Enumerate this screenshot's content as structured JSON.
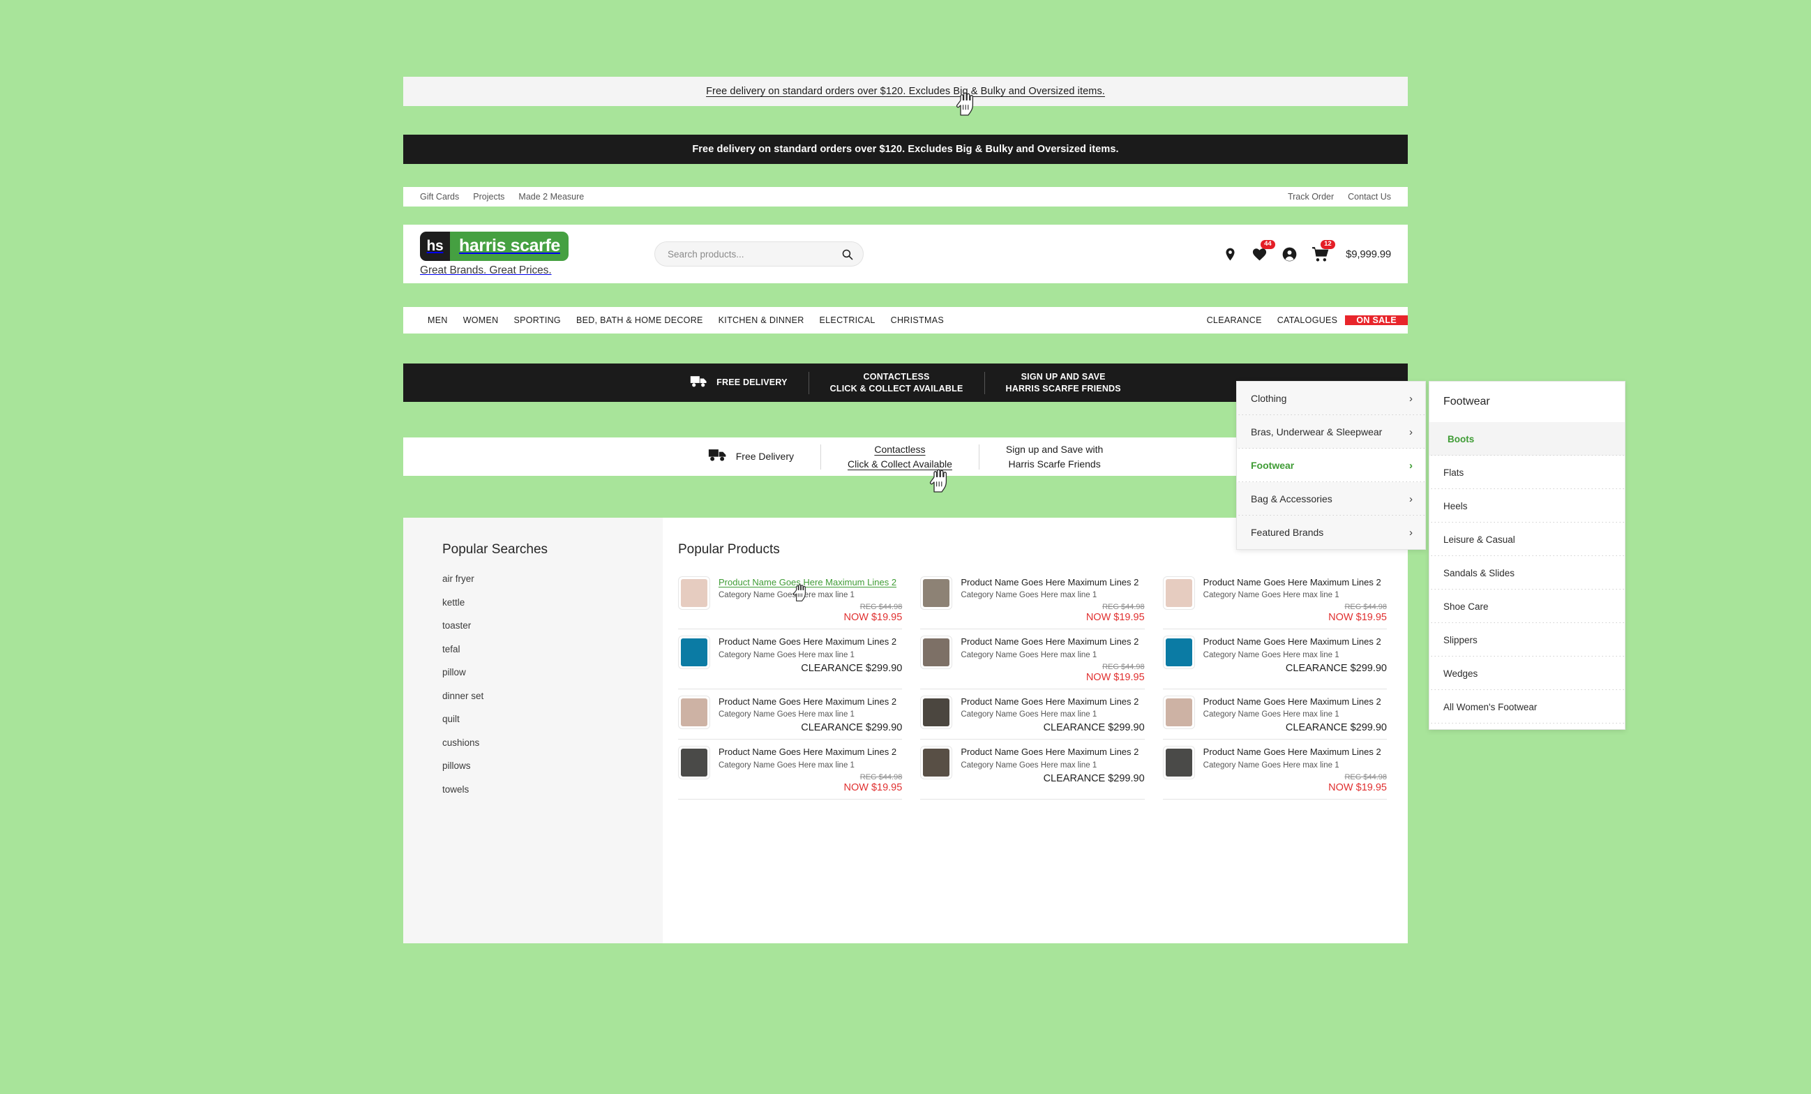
{
  "promo_light": {
    "text": "Free delivery on standard orders over $120. Excludes Big & Bulky and Oversized items."
  },
  "promo_dark": {
    "text": "Free delivery on standard orders over $120. Excludes Big & Bulky and Oversized items."
  },
  "utility": {
    "left": [
      {
        "label": "Gift Cards"
      },
      {
        "label": "Projects"
      },
      {
        "label": "Made 2 Measure"
      }
    ],
    "right": [
      {
        "label": "Track Order"
      },
      {
        "label": "Contact Us"
      }
    ]
  },
  "brand": {
    "mark": "hs",
    "name": "harris scarfe",
    "tagline": "Great Brands. Great Prices.",
    "mark_color": "#1d1d1d",
    "name_color": "#45a041"
  },
  "search": {
    "placeholder": "Search products...",
    "value": ""
  },
  "header_icons": {
    "store_locator": "location-pin-icon",
    "wishlist": {
      "icon": "heart-icon",
      "badge": "44"
    },
    "account": "account-icon",
    "cart": {
      "icon": "cart-icon",
      "badge": "12",
      "total": "$9,999.99"
    },
    "badge_color": "#e41e26"
  },
  "mainnav": {
    "left": [
      {
        "label": "MEN"
      },
      {
        "label": "WOMEN"
      },
      {
        "label": "SPORTING"
      },
      {
        "label": "BED, BATH & HOME DECORE"
      },
      {
        "label": "KITCHEN & DINNER"
      },
      {
        "label": "ELECTRICAL"
      },
      {
        "label": "CHRISTMAS"
      }
    ],
    "right": [
      {
        "label": "CLEARANCE"
      },
      {
        "label": "CATALOGUES"
      }
    ],
    "onsale": {
      "label": "ON SALE",
      "color": "#e8252b"
    }
  },
  "featurebar_dark": {
    "delivery": "FREE DELIVERY",
    "contactless_l1": "CONTACTLESS",
    "contactless_l2": "CLICK & COLLECT AVAILABLE",
    "signup_l1": "SIGN UP AND SAVE",
    "signup_l2": "HARRIS SCARFE FRIENDS"
  },
  "featurebar_light": {
    "delivery": "Free Delivery",
    "contactless_l1": "Contactless",
    "contactless_l2": "Click & Collect Available",
    "signup_l1": "Sign up and Save with",
    "signup_l2": "Harris Scarfe Friends"
  },
  "sidebar": {
    "title": "Popular Searches",
    "items": [
      {
        "label": "air fryer"
      },
      {
        "label": "kettle"
      },
      {
        "label": "toaster"
      },
      {
        "label": "tefal"
      },
      {
        "label": "pillow"
      },
      {
        "label": "dinner set"
      },
      {
        "label": "quilt"
      },
      {
        "label": "cushions"
      },
      {
        "label": "pillows"
      },
      {
        "label": "towels"
      }
    ]
  },
  "products": {
    "title": "Popular Products",
    "items": [
      {
        "name": "Product Name Goes Here Maximum Lines 2",
        "category": "Category Name Goes Here max line 1",
        "reg": "REG $44.98",
        "now": "NOW $19.95",
        "clearance": "",
        "active": true,
        "thumb": "#e6ccc0"
      },
      {
        "name": "Product Name Goes Here Maximum Lines 2",
        "category": "Category Name Goes Here max line 1",
        "reg": "REG $44.98",
        "now": "NOW $19.95",
        "clearance": "",
        "active": false,
        "thumb": "#8d8275"
      },
      {
        "name": "Product Name Goes Here Maximum Lines 2",
        "category": "Category Name Goes Here max line 1",
        "reg": "REG $44.98",
        "now": "NOW $19.95",
        "clearance": "",
        "active": false,
        "thumb": "#e6ccc0"
      },
      {
        "name": "Product Name Goes Here Maximum Lines 2",
        "category": "Category Name Goes Here max line 1",
        "reg": "",
        "now": "",
        "clearance": "CLEARANCE $299.90",
        "active": false,
        "thumb": "#0b7ba4"
      },
      {
        "name": "Product Name Goes Here Maximum Lines 2",
        "category": "Category Name Goes Here max line 1",
        "reg": "REG $44.98",
        "now": "NOW $19.95",
        "clearance": "",
        "active": false,
        "thumb": "#7d7066"
      },
      {
        "name": "Product Name Goes Here Maximum Lines 2",
        "category": "Category Name Goes Here max line 1",
        "reg": "",
        "now": "",
        "clearance": "CLEARANCE $299.90",
        "active": false,
        "thumb": "#0b7ba4"
      },
      {
        "name": "Product Name Goes Here Maximum Lines 2",
        "category": "Category Name Goes Here max line 1",
        "reg": "",
        "now": "",
        "clearance": "CLEARANCE $299.90",
        "active": false,
        "thumb": "#cdb2a4"
      },
      {
        "name": "Product Name Goes Here Maximum Lines 2",
        "category": "Category Name Goes Here max line 1",
        "reg": "",
        "now": "",
        "clearance": "CLEARANCE $299.90",
        "active": false,
        "thumb": "#4b463f"
      },
      {
        "name": "Product Name Goes Here Maximum Lines 2",
        "category": "Category Name Goes Here max line 1",
        "reg": "",
        "now": "",
        "clearance": "CLEARANCE $299.90",
        "active": false,
        "thumb": "#cdb2a4"
      },
      {
        "name": "Product Name Goes Here Maximum Lines 2",
        "category": "Category Name Goes Here max line 1",
        "reg": "REG $44.98",
        "now": "NOW $19.95",
        "clearance": "",
        "active": false,
        "thumb": "#4a4a48"
      },
      {
        "name": "Product Name Goes Here Maximum Lines 2",
        "category": "Category Name Goes Here max line 1",
        "reg": "",
        "now": "",
        "clearance": "CLEARANCE $299.90",
        "active": false,
        "thumb": "#584f45"
      },
      {
        "name": "Product Name Goes Here Maximum Lines 2",
        "category": "Category Name Goes Here max line 1",
        "reg": "REG $44.98",
        "now": "NOW $19.95",
        "clearance": "",
        "active": false,
        "thumb": "#4a4a48"
      }
    ]
  },
  "menu_l1": {
    "items": [
      {
        "label": "Clothing",
        "active": false
      },
      {
        "label": "Bras, Underwear & Sleepwear",
        "active": false
      },
      {
        "label": "Footwear",
        "active": true
      },
      {
        "label": "Bag & Accessories",
        "active": false
      },
      {
        "label": "Featured Brands",
        "active": false
      }
    ],
    "chevron": "chevron-right-icon",
    "active_color": "#3f9c35"
  },
  "menu_l2": {
    "title": "Footwear",
    "items": [
      {
        "label": "Boots",
        "active": true
      },
      {
        "label": "Flats",
        "active": false
      },
      {
        "label": "Heels",
        "active": false
      },
      {
        "label": "Leisure & Casual",
        "active": false
      },
      {
        "label": "Sandals & Slides",
        "active": false
      },
      {
        "label": "Shoe Care",
        "active": false
      },
      {
        "label": "Slippers",
        "active": false
      },
      {
        "label": "Wedges",
        "active": false
      },
      {
        "label": "All Women's Footwear",
        "active": false
      }
    ]
  }
}
